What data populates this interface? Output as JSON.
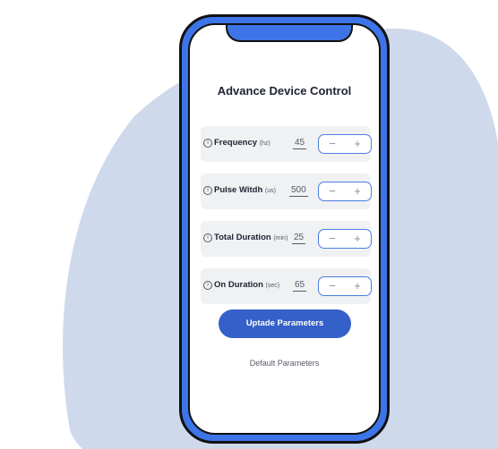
{
  "title": "Advance Device Control",
  "parameters": [
    {
      "label": "Frequency",
      "unit": "(hz)",
      "value": "45"
    },
    {
      "label": "Pulse Witdh",
      "unit": "(us)",
      "value": "500"
    },
    {
      "label": "Total Duration",
      "unit": "(min)",
      "value": "25"
    },
    {
      "label": "On Duration",
      "unit": "(sec)",
      "value": "65"
    }
  ],
  "stepper": {
    "minus": "−",
    "plus": "+"
  },
  "info_glyph": "i",
  "buttons": {
    "update": "Uptade Parameters",
    "default": "Default Parameters"
  },
  "colors": {
    "phone_frame": "#3d74e8",
    "primary_button": "#3560c9",
    "background_blob": "#cfd9ec"
  }
}
